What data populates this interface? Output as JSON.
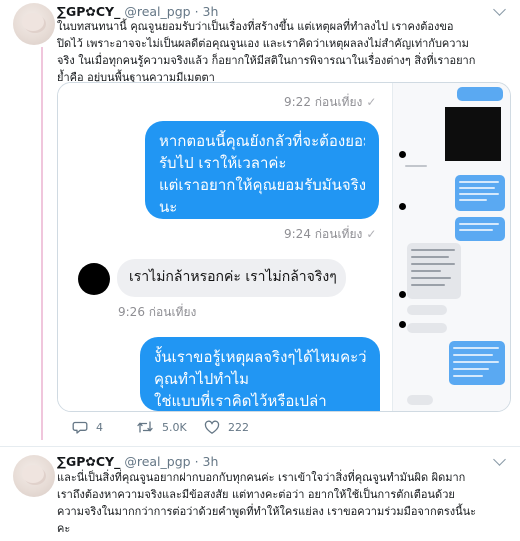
{
  "tweet1": {
    "name": "∑GP✿CY_",
    "handle": "@real_pgp",
    "separator": "·",
    "time": "3h",
    "text_lines": [
      "ในบทสนทนานี้ คุณจูนยอมรับว่าเป็นเรื่องที่สร้างขึ้น แต่เหตุผลที่ทำลงไป เราคงต้องขอ",
      "ปิดไว้ เพราะอาจจะไม่เป็นผลดีต่อคุณจูนเอง และเราคิดว่าเหตุผลลงไม่สำคัญเท่ากับความ",
      "จริง ในเมื่อทุกคนรู้ความจริงแล้ว ก็อยากให้มีสติในการพิจารณาในเรื่องต่างๆ สิ่งที่เราอยาก",
      "ย้ำคือ อยู่บนพื้นฐานความมีเมตตา"
    ],
    "chat": {
      "ts1": "9:22 ก่อนเที่ยง",
      "bubble1_lines": [
        "หากตอนนี้คุณยังกลัวที่จะต้องยอม",
        "รับไป เราให้เวลาค่ะ",
        "แต่เราอยากให้คุณยอมรับมันจริงๆ",
        "นะ"
      ],
      "ts2": "9:24 ก่อนเที่ยง",
      "bubble2": "เราไม่กล้าหรอกค่ะ เราไม่กล้าจริงๆ",
      "ts3": "9:26 ก่อนเที่ยง",
      "bubble3_lines": [
        "งั้นเราขอรู้เหตุผลจริงๆได้ไหมคะว่า",
        "คุณทำไปทำไม",
        "ใช่แบบที่เราคิดไว้หรือเปล่า"
      ],
      "check": "✓"
    },
    "actions": {
      "reply_count": "4",
      "retweet_count": "5.0K",
      "like_count": "222"
    }
  },
  "tweet2": {
    "name": "∑GP✿CY_",
    "handle": "@real_pgp",
    "separator": "·",
    "time": "3h",
    "text_lines": [
      "และนี่เป็นสิ่งที่คุณจูนอยากฝากบอกกับทุกคนค่ะ เราเข้าใจว่าสิ่งที่คุณจูนทำมันผิด ผิดมาก",
      "เราถึงต้องหาความจริงและมีข้อสงสัย แต่ทางคะต่อว่า อยากให้ใช้เป็นการตักเตือนด้วย",
      "ความจริงในมากกว่าการต่อว่าด้วยคำพูดที่ทำให้ใครแย่ลง เราขอความร่วมมือจากตรงนี้นะ",
      "คะ"
    ]
  },
  "colors": {
    "accent_blue": "#2196f3",
    "thread_line": "#f0c6dc",
    "muted_text": "#657786"
  },
  "icons": {
    "reply": "reply-icon",
    "retweet": "retweet-icon",
    "like": "heart-icon",
    "chevron": "chevron-down-icon"
  }
}
